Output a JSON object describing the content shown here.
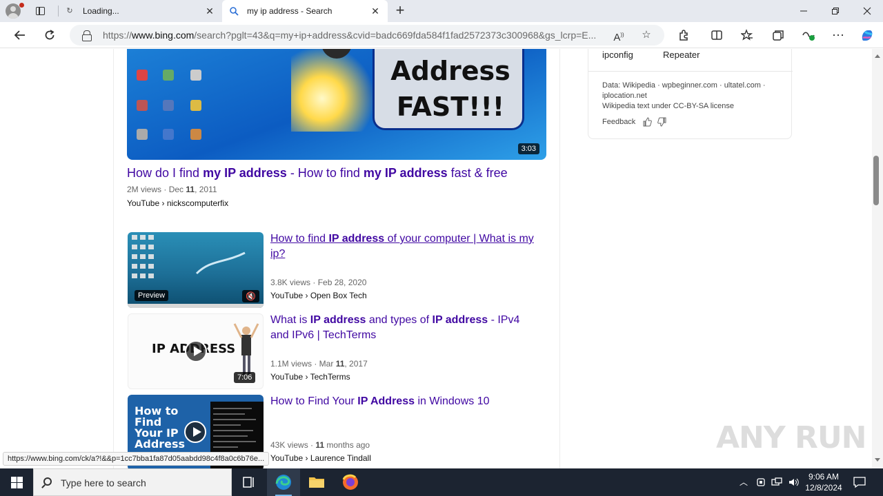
{
  "browser": {
    "tabs": [
      {
        "title": "Loading...",
        "favicon": "loading-icon",
        "active": false
      },
      {
        "title": "my ip address - Search",
        "favicon": "search-icon",
        "active": true
      }
    ],
    "url_prefix": "https://",
    "url_host": "www.bing.com",
    "url_rest": "/search?pglt=43&q=my+ip+address&cvid=badc669fda584f1fad2572373c300968&gs_lcrp=E..."
  },
  "top_video": {
    "thumb_text_line1": "Address",
    "thumb_text_line2": "FAST!!!",
    "duration": "3:03",
    "title_parts": [
      "How do I find ",
      "my IP address",
      " - How to find ",
      "my IP address",
      " fast & free"
    ],
    "views": "2M views",
    "date_prefix": "Dec ",
    "date_bold": "11",
    "date_suffix": ", 2011",
    "source": "YouTube › nickscomputerfix"
  },
  "videos": [
    {
      "title_parts": [
        "How to find ",
        "IP address",
        " of your computer | What is my ip?"
      ],
      "meta": "3.8K views · Feb 28, 2020",
      "source": "YouTube › Open Box Tech",
      "badge": "Preview",
      "muted": true
    },
    {
      "title_parts": [
        "What is ",
        "IP address",
        " and types of ",
        "IP address",
        " - IPv4 and IPv6 | TechTerms"
      ],
      "thumb_text": "IP ADDRESS",
      "meta_views": "1.1M views · Mar ",
      "meta_bold": "11",
      "meta_end": ", 2017",
      "source": "YouTube › TechTerms",
      "duration": "7:06"
    },
    {
      "title_parts": [
        "How to Find Your ",
        "IP Address",
        " in Windows 10"
      ],
      "thumb_text": [
        "How to",
        "Find",
        "Your IP",
        "Address"
      ],
      "meta_views": "43K views · ",
      "meta_bold": "11",
      "meta_end": " months ago",
      "source": "YouTube › Laurence Tindall"
    }
  ],
  "right_panel": {
    "chips": [
      "ipconfig",
      "Repeater"
    ],
    "data_line1": "Data: Wikipedia · wpbeginner.com · ultatel.com ·",
    "data_line2": "iplocation.net",
    "data_line3": "Wikipedia text under CC-BY-SA license",
    "feedback": "Feedback"
  },
  "status_url": "https://www.bing.com/ck/a?!&&p=1cc7bba1fa87d05aabdd98c4f8a0c6b76e...",
  "watermark": "ANY RUN",
  "taskbar": {
    "search_placeholder": "Type here to search",
    "time": "9:06 AM",
    "date": "12/8/2024"
  },
  "colors": {
    "link": "#4007a2",
    "taskbar": "#1c2431",
    "accent": "#76b9ed"
  }
}
